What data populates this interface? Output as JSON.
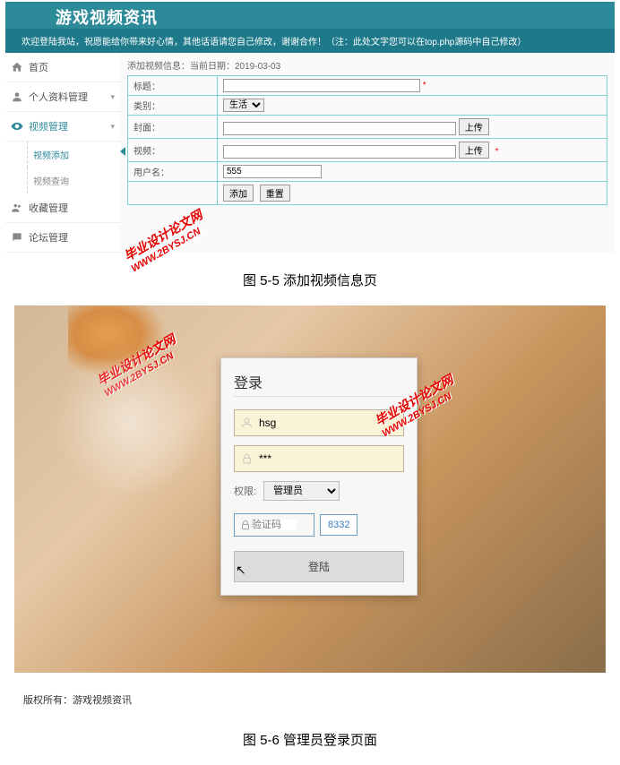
{
  "screenshot1": {
    "site_title": "游戏视频资讯",
    "welcome_text": "欢迎登陆我站，祝愿能给你带来好心情，其他话语请您自己修改，谢谢合作！（注：此处文字您可以在top.php源码中自己修改）",
    "nav": {
      "home": "首页",
      "profile": "个人资料管理",
      "video": "视频管理",
      "video_add": "视频添加",
      "video_query": "视频查询",
      "favorites": "收藏管理",
      "forum": "论坛管理"
    },
    "page_header": "添加视频信息：当前日期：2019-03-03",
    "form": {
      "label_title": "标题：",
      "label_category": "类别：",
      "label_cover": "封面：",
      "label_video": "视频：",
      "label_user": "用户名：",
      "category_value": "生活",
      "upload_btn": "上传",
      "user_value": "555",
      "btn_add": "添加",
      "btn_reset": "重置"
    }
  },
  "caption1": "图 5-5  添加视频信息页",
  "watermark": {
    "line1": "毕业设计论文网",
    "line2": "WWW.2BYSJ.CN"
  },
  "screenshot2": {
    "login_title": "登录",
    "username": "hsg",
    "password": "***",
    "role_label": "权限:",
    "role_value": "管理员",
    "captcha_placeholder": "验证码",
    "captcha_code": "8332",
    "login_btn": "登陆",
    "footer": "版权所有：游戏视频资讯"
  },
  "caption2": "图 5-6 管理员登录页面"
}
